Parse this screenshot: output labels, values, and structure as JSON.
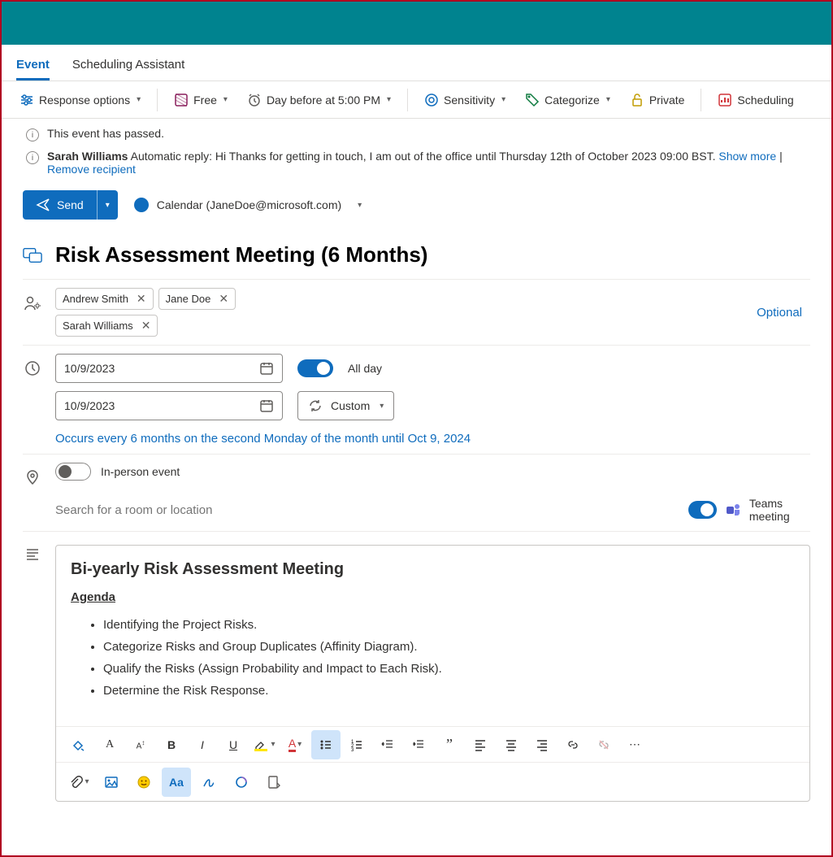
{
  "tabs": {
    "event": "Event",
    "scheduling": "Scheduling Assistant"
  },
  "toolbar": {
    "response": "Response options",
    "busy": "Free",
    "reminder": "Day before at 5:00 PM",
    "sensitivity": "Sensitivity",
    "categorize": "Categorize",
    "private": "Private",
    "schedulingPoll": "Scheduling"
  },
  "banner": {
    "passed": "This event has passed.",
    "autoName": "Sarah Williams",
    "autoText": "Automatic reply: Hi Thanks for getting in touch, I am out of the office until Thursday 12th of October 2023 09:00 BST.",
    "showMore": "Show more",
    "sep": " | ",
    "removeRecipient": "Remove recipient"
  },
  "send": "Send",
  "calendar": {
    "prefix": "Calendar (",
    "user": "JaneDoe",
    "suffix": "@microsoft.com)"
  },
  "title": "Risk Assessment Meeting (6 Months)",
  "attendees": {
    "req": [
      "Andrew Smith",
      "Jane Doe"
    ],
    "opt": [
      "Sarah Williams"
    ],
    "optionalLabel": "Optional"
  },
  "dates": {
    "start": "10/9/2023",
    "end": "10/9/2023",
    "allDay": "All day",
    "recurLabel": "Custom",
    "recurText": "Occurs every 6 months on the second Monday of the month until Oct 9, 2024"
  },
  "inperson": "In-person event",
  "locationPlaceholder": "Search for a room or location",
  "teamsLabel": "Teams meeting",
  "desc": {
    "heading": "Bi-yearly Risk Assessment Meeting",
    "agenda": "Agenda",
    "items": [
      "Identifying the Project Risks.",
      "Categorize Risks and Group Duplicates (Affinity Diagram).",
      "Qualify the Risks (Assign Probability and Impact to Each Risk).",
      "Determine the Risk Response."
    ]
  }
}
